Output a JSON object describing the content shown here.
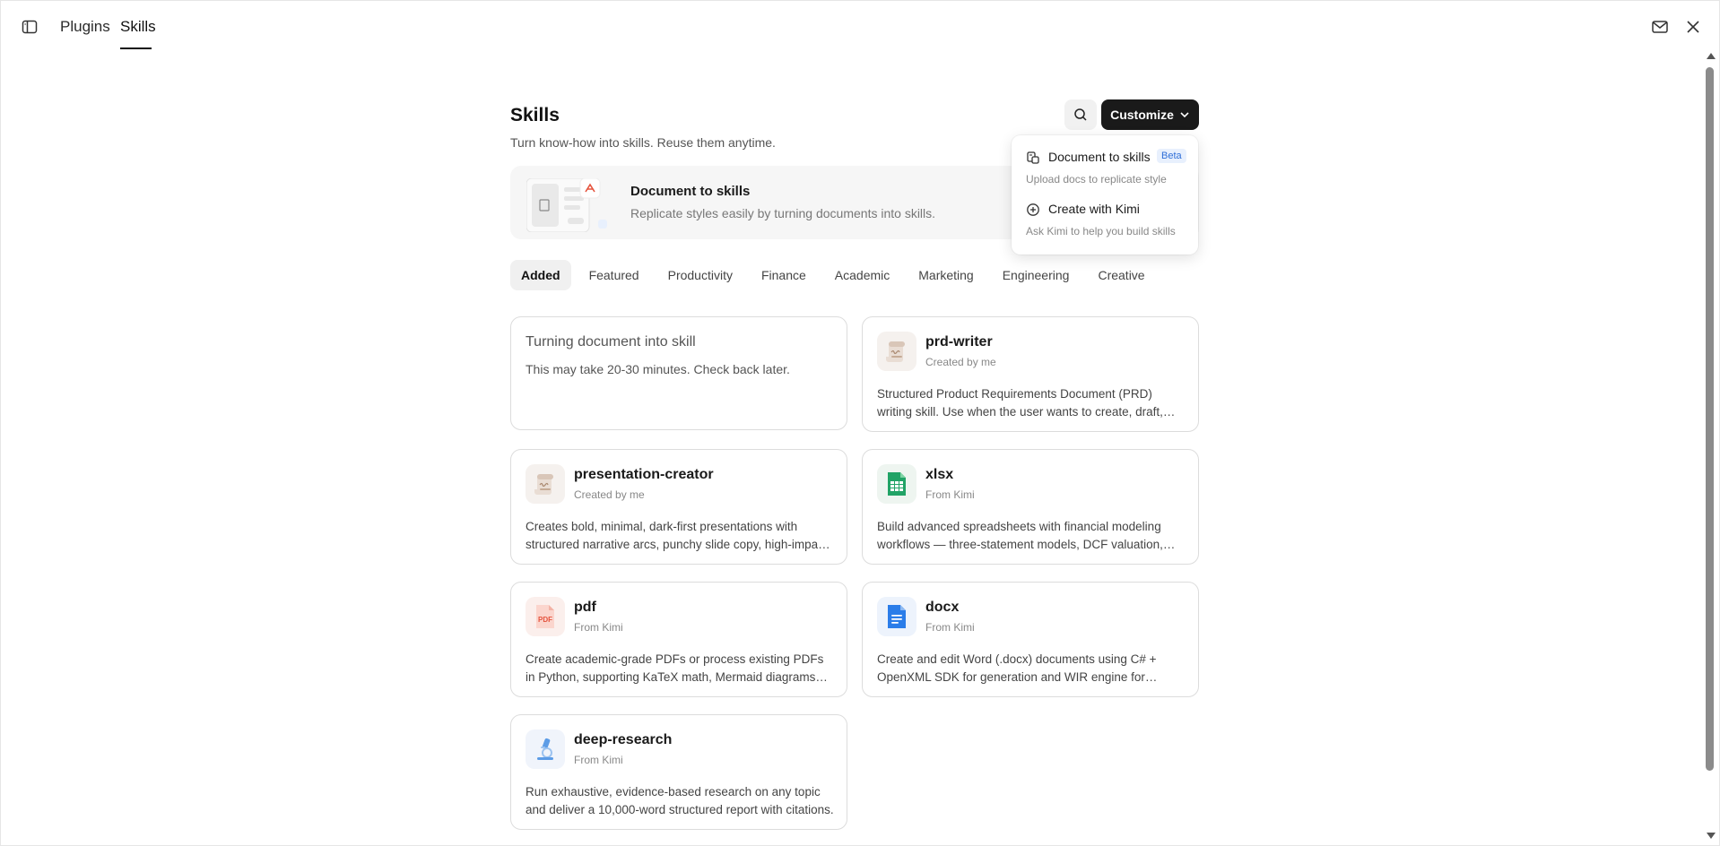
{
  "topbar": {
    "tabs": [
      {
        "label": "Plugins"
      },
      {
        "label": "Skills"
      }
    ]
  },
  "header": {
    "title": "Skills",
    "subtitle": "Turn know-how into skills. Reuse them anytime.",
    "customize_label": "Customize"
  },
  "banner": {
    "title": "Document to skills",
    "description": "Replicate styles easily by turning documents into skills."
  },
  "filters": [
    {
      "label": "Added"
    },
    {
      "label": "Featured"
    },
    {
      "label": "Productivity"
    },
    {
      "label": "Finance"
    },
    {
      "label": "Academic"
    },
    {
      "label": "Marketing"
    },
    {
      "label": "Engineering"
    },
    {
      "label": "Creative"
    }
  ],
  "pending_card": {
    "title": "Turning document into skill",
    "description": "This may take 20-30 minutes. Check back later."
  },
  "cards": [
    {
      "name": "prd-writer",
      "source": "Created by me",
      "description": "Structured Product Requirements Document (PRD) writing skill. Use when the user wants to create, draft, review or refine a PRD.",
      "icon": "scroll-icon"
    },
    {
      "name": "presentation-creator",
      "source": "Created by me",
      "description": "Creates bold, minimal, dark-first presentations with structured narrative arcs, punchy slide copy, high-impact visuals.",
      "icon": "scroll-icon"
    },
    {
      "name": "xlsx",
      "source": "From Kimi",
      "description": "Build advanced spreadsheets with financial modeling workflows — three-statement models, DCF valuation, and more.",
      "icon": "spreadsheet-icon"
    },
    {
      "name": "pdf",
      "source": "From Kimi",
      "description": "Create academic-grade PDFs or process existing PDFs in Python, supporting KaTeX math, Mermaid diagrams and more.",
      "icon": "pdf-icon"
    },
    {
      "name": "docx",
      "source": "From Kimi",
      "description": "Create and edit Word (.docx) documents using C# + OpenXML SDK for generation and WIR engine for editing.",
      "icon": "document-icon"
    },
    {
      "name": "deep-research",
      "source": "From Kimi",
      "description": "Run exhaustive, evidence-based research on any topic and deliver a 10,000-word structured report with citations.",
      "icon": "microscope-icon"
    }
  ],
  "dropdown": {
    "items": [
      {
        "label": "Document to skills",
        "badge": "Beta",
        "sub": "Upload docs to replicate style"
      },
      {
        "label": "Create with Kimi",
        "sub": "Ask Kimi to help you build skills"
      }
    ]
  },
  "icon_pdf_text": "PDF",
  "colors": {
    "accent_dark": "#1a1a1a",
    "beta_badge": "#2f6fd8",
    "xlsx_green": "#21a366",
    "pdf_red": "#e5533d",
    "docx_blue": "#2b7de9"
  }
}
